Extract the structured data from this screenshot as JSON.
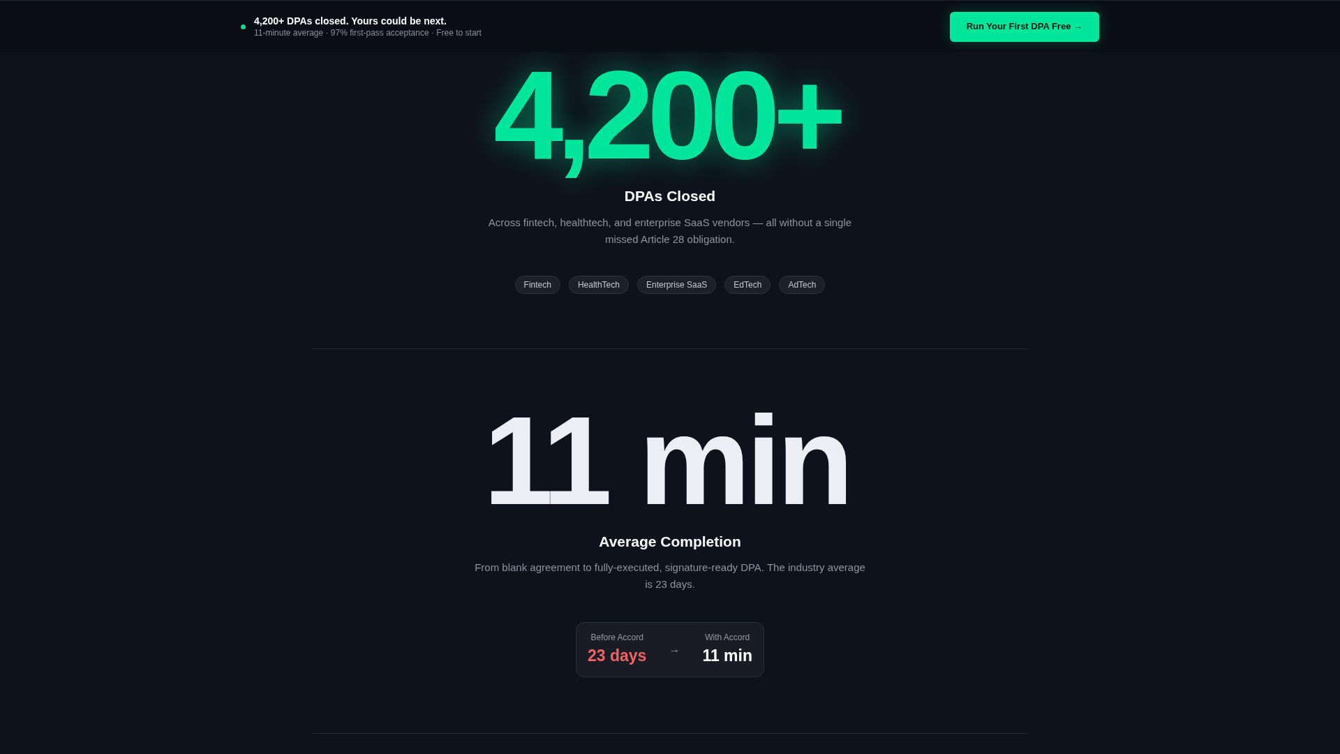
{
  "banner": {
    "headline": "4,200+ DPAs closed. Yours could be next.",
    "subline": "11-minute average · 97% first-pass acceptance · Free to start",
    "cta": "Run Your First DPA Free →"
  },
  "stats": [
    {
      "kind": "tags",
      "value": "4,200+",
      "label": "DPAs Closed",
      "description": "Across fintech, healthtech, and enterprise SaaS vendors — all without a single missed Article 28 obligation.",
      "tags": [
        "Fintech",
        "HealthTech",
        "Enterprise SaaS",
        "EdTech",
        "AdTech"
      ]
    },
    {
      "kind": "comparison",
      "value": "11 min",
      "label": "Average Completion",
      "description": "From blank agreement to fully-executed, signature-ready DPA. The industry average is 23 days.",
      "comparison": {
        "before_label": "Before Accord",
        "before_value": "23 days",
        "arrow": "→",
        "after_label": "With Accord",
        "after_value": "11 min"
      }
    }
  ]
}
